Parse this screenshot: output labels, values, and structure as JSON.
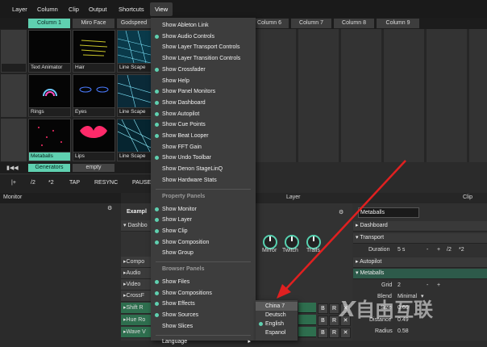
{
  "menubar": {
    "items": [
      "Layer",
      "Column",
      "Clip",
      "Output",
      "Shortcuts",
      "View"
    ]
  },
  "columns": [
    "Column 1",
    "Miro Face",
    "Godspeed",
    "",
    "",
    "Column 6",
    "Column 7",
    "Column 8",
    "Column 9"
  ],
  "clips": {
    "row1": [
      "Text Animator",
      "Hair",
      "Line Scape"
    ],
    "row2": [
      "Rings",
      "Eyes",
      "Line Scape"
    ],
    "row3": [
      "Metaballs",
      "Lips",
      "Line Scape"
    ]
  },
  "layer_strip": {
    "generators": "Generators",
    "empty": "empty"
  },
  "transport": {
    "items": [
      "|+",
      "/2",
      "*2",
      "TAP",
      "RESYNC",
      "PAUSE"
    ]
  },
  "monitor": {
    "title": "Monitor"
  },
  "layer_bar": {
    "label": "Layer",
    "clip_label": "Clip"
  },
  "layer_panel": {
    "example_label": "Exampl",
    "dashboard": "Dashbo",
    "knobs": [
      "Mirror",
      "Twitch",
      "Trails"
    ],
    "rows": [
      "Compo",
      "Audio",
      "Video",
      "CrossF",
      "Shift R",
      "Hue Ro",
      "Wave V"
    ]
  },
  "clip_panel": {
    "name": "Metaballs",
    "sections": [
      "Dashboard",
      "Transport",
      "Autopilot",
      "Metaballs"
    ],
    "duration_label": "Duration",
    "duration_value": "5 s",
    "dur_controls": [
      "-",
      "+",
      "/2",
      "*2"
    ],
    "grid_label": "Grid",
    "grid_value": "2",
    "blend_label": "Blend",
    "blend_value": "Minimal",
    "size_label": "Size",
    "size_value": "0.60",
    "distance_label": "Distance",
    "distance_value": "0.49",
    "radius_label": "Radius",
    "radius_value": "0.58"
  },
  "view_menu": {
    "items": [
      {
        "label": "Show Ableton Link",
        "checked": false
      },
      {
        "label": "Show Audio Controls",
        "checked": true
      },
      {
        "label": "Show Layer Transport Controls",
        "checked": false
      },
      {
        "label": "Show Layer Transition Controls",
        "checked": false
      },
      {
        "label": "Show Crossfader",
        "checked": true
      },
      {
        "label": "Show Help",
        "checked": false
      },
      {
        "label": "Show Panel Monitors",
        "checked": true
      },
      {
        "label": "Show Dashboard",
        "checked": true
      },
      {
        "label": "Show Autopilot",
        "checked": true
      },
      {
        "label": "Show Cue Points",
        "checked": true
      },
      {
        "label": "Show Beat Looper",
        "checked": true
      },
      {
        "label": "Show FFT Gain",
        "checked": false
      },
      {
        "label": "Show Undo Toolbar",
        "checked": true
      },
      {
        "label": "Show Denon StageLinQ",
        "checked": false
      },
      {
        "label": "Show Hardware Stats",
        "checked": false
      }
    ],
    "property_header": "Property Panels",
    "property_items": [
      {
        "label": "Show Monitor",
        "checked": true
      },
      {
        "label": "Show Layer",
        "checked": true
      },
      {
        "label": "Show Clip",
        "checked": true
      },
      {
        "label": "Show Composition",
        "checked": true
      },
      {
        "label": "Show Group",
        "checked": false
      }
    ],
    "browser_header": "Browser Panels",
    "browser_items": [
      {
        "label": "Show Files",
        "checked": true
      },
      {
        "label": "Show Compositions",
        "checked": true
      },
      {
        "label": "Show Effects",
        "checked": true
      },
      {
        "label": "Show Sources",
        "checked": true
      },
      {
        "label": "Show Slices",
        "checked": false
      }
    ],
    "language_label": "Language"
  },
  "language_menu": {
    "items": [
      {
        "label": "China 7",
        "checked": false,
        "highlight": true
      },
      {
        "label": "Deutsch",
        "checked": false
      },
      {
        "label": "English",
        "checked": true
      },
      {
        "label": "Espanol",
        "checked": false
      }
    ]
  },
  "watermark": "自由互联",
  "colors": {
    "accent": "#5fd0b0",
    "arrow": "#e02020",
    "menu_bg": "#3d3d3d"
  }
}
